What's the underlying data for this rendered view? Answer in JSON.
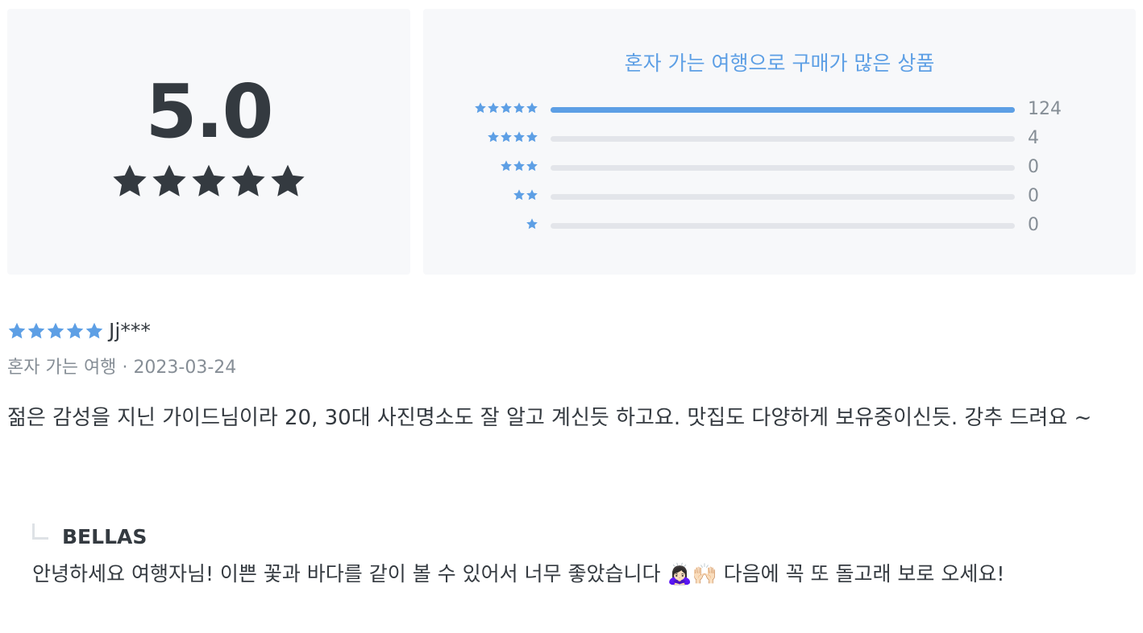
{
  "summary": {
    "average": "5.0",
    "star_count": 5,
    "star_color": "#343a40"
  },
  "distribution": {
    "title": "혼자 가는 여행으로 구매가 많은 상품",
    "accent": "#5d9fe5",
    "rows": [
      {
        "stars": 5,
        "count": "124",
        "fraction": 1.0
      },
      {
        "stars": 4,
        "count": "4",
        "fraction": 0.0
      },
      {
        "stars": 3,
        "count": "0",
        "fraction": 0.0
      },
      {
        "stars": 2,
        "count": "0",
        "fraction": 0.0
      },
      {
        "stars": 1,
        "count": "0",
        "fraction": 0.0
      }
    ]
  },
  "review": {
    "rating": 5,
    "reviewer": "Jj***",
    "category": "혼자 가는 여행",
    "separator": "·",
    "date": "2023-03-24",
    "body": "젊은 감성을 지닌 가이드님이라 20, 30대 사진명소도 잘 알고 계신듯 하고요. 맛집도 다양하게 보유중이신듯. 강추 드려요 ~",
    "reply": {
      "author": "BELLAS",
      "text": "안녕하세요 여행자님! 이쁜 꽃과 바다를 같이 볼 수 있어서 너무 좋았습니다 🙇🏻‍♀️🙌🏻 다음에 꼭 또 돌고래 보로 오세요!"
    }
  }
}
